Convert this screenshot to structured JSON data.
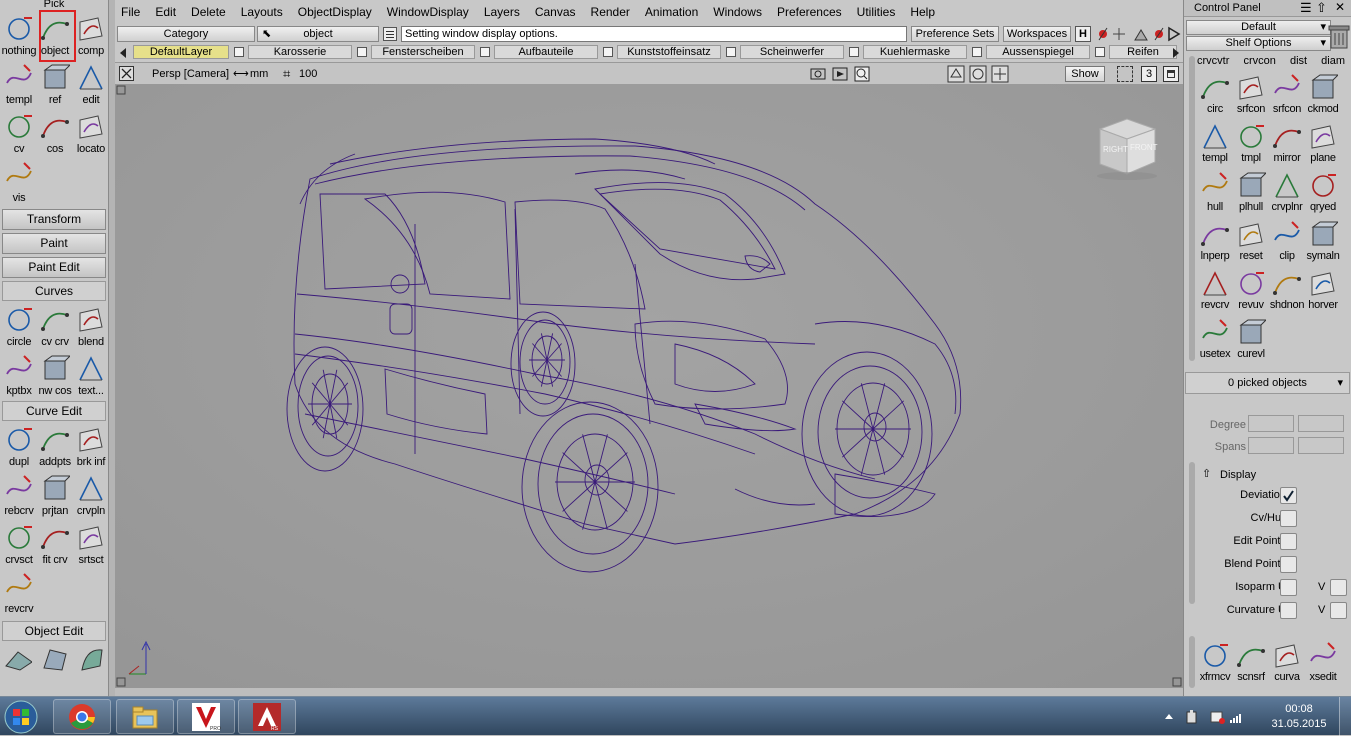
{
  "left_palette": {
    "pick_title": "Pick",
    "pick_tools": [
      {
        "label": "nothing",
        "icon": "pick-nothing-icon"
      },
      {
        "label": "object",
        "icon": "pick-object-icon",
        "selected": true
      },
      {
        "label": "comp",
        "icon": "pick-component-icon"
      },
      {
        "label": "templ",
        "icon": "pick-template-icon"
      },
      {
        "label": "ref",
        "icon": "pick-reference-icon"
      },
      {
        "label": "edit",
        "icon": "pick-edit-icon"
      },
      {
        "label": "cv",
        "icon": "pick-cv-icon"
      },
      {
        "label": "cos",
        "icon": "pick-cos-icon"
      },
      {
        "label": "locato",
        "icon": "pick-locator-icon"
      },
      {
        "label": "vis",
        "icon": "pick-visible-icon"
      }
    ],
    "transform_label": "Transform",
    "paint_label": "Paint",
    "paint_edit_label": "Paint Edit",
    "curves_title": "Curves",
    "curves_tools": [
      {
        "label": "circle",
        "icon": "circle-icon"
      },
      {
        "label": "cv crv",
        "icon": "cv-curve-icon"
      },
      {
        "label": "blend",
        "icon": "blend-curve-icon"
      },
      {
        "label": "kptbx",
        "icon": "keypoint-icon"
      },
      {
        "label": "nw cos",
        "icon": "new-cos-icon"
      },
      {
        "label": "text...",
        "icon": "text-tool-icon"
      }
    ],
    "curve_edit_title": "Curve Edit",
    "curve_edit_tools": [
      {
        "label": "dupl",
        "icon": "duplicate-curve-icon"
      },
      {
        "label": "addpts",
        "icon": "add-points-icon"
      },
      {
        "label": "brk inf",
        "icon": "break-inflection-icon"
      },
      {
        "label": "rebcrv",
        "icon": "rebuild-curve-icon"
      },
      {
        "label": "prjtan",
        "icon": "project-tangent-icon"
      },
      {
        "label": "crvpln",
        "icon": "curve-plane-icon"
      },
      {
        "label": "crvsct",
        "icon": "curve-section-icon"
      },
      {
        "label": "fit crv",
        "icon": "fit-curve-icon"
      },
      {
        "label": "srtsct",
        "icon": "sort-section-icon"
      },
      {
        "label": "revcrv",
        "icon": "reverse-curve-icon"
      }
    ],
    "object_edit_title": "Object Edit"
  },
  "menu": [
    "File",
    "Edit",
    "Delete",
    "Layouts",
    "ObjectDisplay",
    "WindowDisplay",
    "Layers",
    "Canvas",
    "Render",
    "Animation",
    "Windows",
    "Preferences",
    "Utilities",
    "Help"
  ],
  "toolbar": {
    "category_label": "Category",
    "current_tool": "object",
    "prompt_text": "Setting window display options.",
    "preference_sets": "Preference Sets",
    "workspaces": "Workspaces"
  },
  "layers": [
    "DefaultLayer",
    "Karosserie",
    "Fensterscheiben",
    "Aufbauteile",
    "Kunststoffeinsatz",
    "Scheinwerfer",
    "Kuehlermaske",
    "Aussenspiegel",
    "Reifen"
  ],
  "viewport": {
    "camera": "Persp [Camera]",
    "units": "mm",
    "grid_value": "100",
    "show_label": "Show",
    "window_count": "3",
    "viewcube_right": "RIGHT",
    "viewcube_front": "FRONT",
    "wire_color": "#3a1a7a"
  },
  "control_panel": {
    "title": "Control Panel",
    "default_label": "Default",
    "shelf_options": "Shelf Options",
    "shelf_tools": [
      {
        "label": "crvcvtr",
        "icon": "curve-convert-icon"
      },
      {
        "label": "crvcon",
        "icon": "curve-continuity-icon"
      },
      {
        "label": "dist",
        "icon": "distance-icon"
      },
      {
        "label": "diam",
        "icon": "diameter-icon"
      },
      {
        "label": "circ",
        "icon": "circle-check-icon"
      },
      {
        "label": "srfcon",
        "icon": "surface-continuity-icon"
      },
      {
        "label": "srfcon",
        "icon": "surface-continuity-2-icon"
      },
      {
        "label": "ckmod",
        "icon": "check-model-icon"
      },
      {
        "label": "templ",
        "icon": "template-icon"
      },
      {
        "label": "tmpl",
        "icon": "template-2-icon"
      },
      {
        "label": "mirror",
        "icon": "mirror-icon"
      },
      {
        "label": "plane",
        "icon": "plane-icon"
      },
      {
        "label": "hull",
        "icon": "hull-icon"
      },
      {
        "label": "plhull",
        "icon": "planar-hull-icon"
      },
      {
        "label": "crvplnr",
        "icon": "curve-planar-icon"
      },
      {
        "label": "qryed",
        "icon": "query-edit-icon"
      },
      {
        "label": "lnperp",
        "icon": "line-perpendicular-icon"
      },
      {
        "label": "reset",
        "icon": "reset-icon"
      },
      {
        "label": "clip",
        "icon": "clip-icon"
      },
      {
        "label": "symaln",
        "icon": "symmetry-align-icon"
      },
      {
        "label": "revcrv",
        "icon": "reverse-curve-icon"
      },
      {
        "label": "revuv",
        "icon": "reverse-uv-icon"
      },
      {
        "label": "shdnon",
        "icon": "shade-on-icon"
      },
      {
        "label": "horver",
        "icon": "horizontal-vertical-icon"
      },
      {
        "label": "usetex",
        "icon": "use-texture-icon"
      },
      {
        "label": "curevl",
        "icon": "curvature-eval-icon"
      }
    ],
    "picked_objects": "0 picked objects",
    "degree_label": "Degree",
    "spans_label": "Spans",
    "display_title": "Display",
    "display_rows": [
      {
        "label": "Deviation",
        "checked": true,
        "v": false
      },
      {
        "label": "Cv/Hull",
        "checked": false,
        "v": false
      },
      {
        "label": "Edit Points",
        "checked": false,
        "v": false
      },
      {
        "label": "Blend Points",
        "checked": false,
        "v": false
      },
      {
        "label": "Isoparm U",
        "checked": false,
        "v": true
      },
      {
        "label": "Curvature U",
        "checked": false,
        "v": true
      }
    ],
    "v_label": "V",
    "bottom_tools": [
      {
        "label": "xfrmcv",
        "icon": "transform-cv-icon"
      },
      {
        "label": "scnsrf",
        "icon": "scan-surface-icon"
      },
      {
        "label": "curva",
        "icon": "curvature-icon"
      },
      {
        "label": "xsedit",
        "icon": "cross-section-edit-icon"
      }
    ]
  },
  "taskbar": {
    "time": "00:08",
    "date": "31.05.2015",
    "apps": [
      "start-orb-icon",
      "chrome-icon",
      "explorer-icon",
      "autodesk-alias-pro-icon",
      "autodesk-alias-rs-icon"
    ]
  }
}
